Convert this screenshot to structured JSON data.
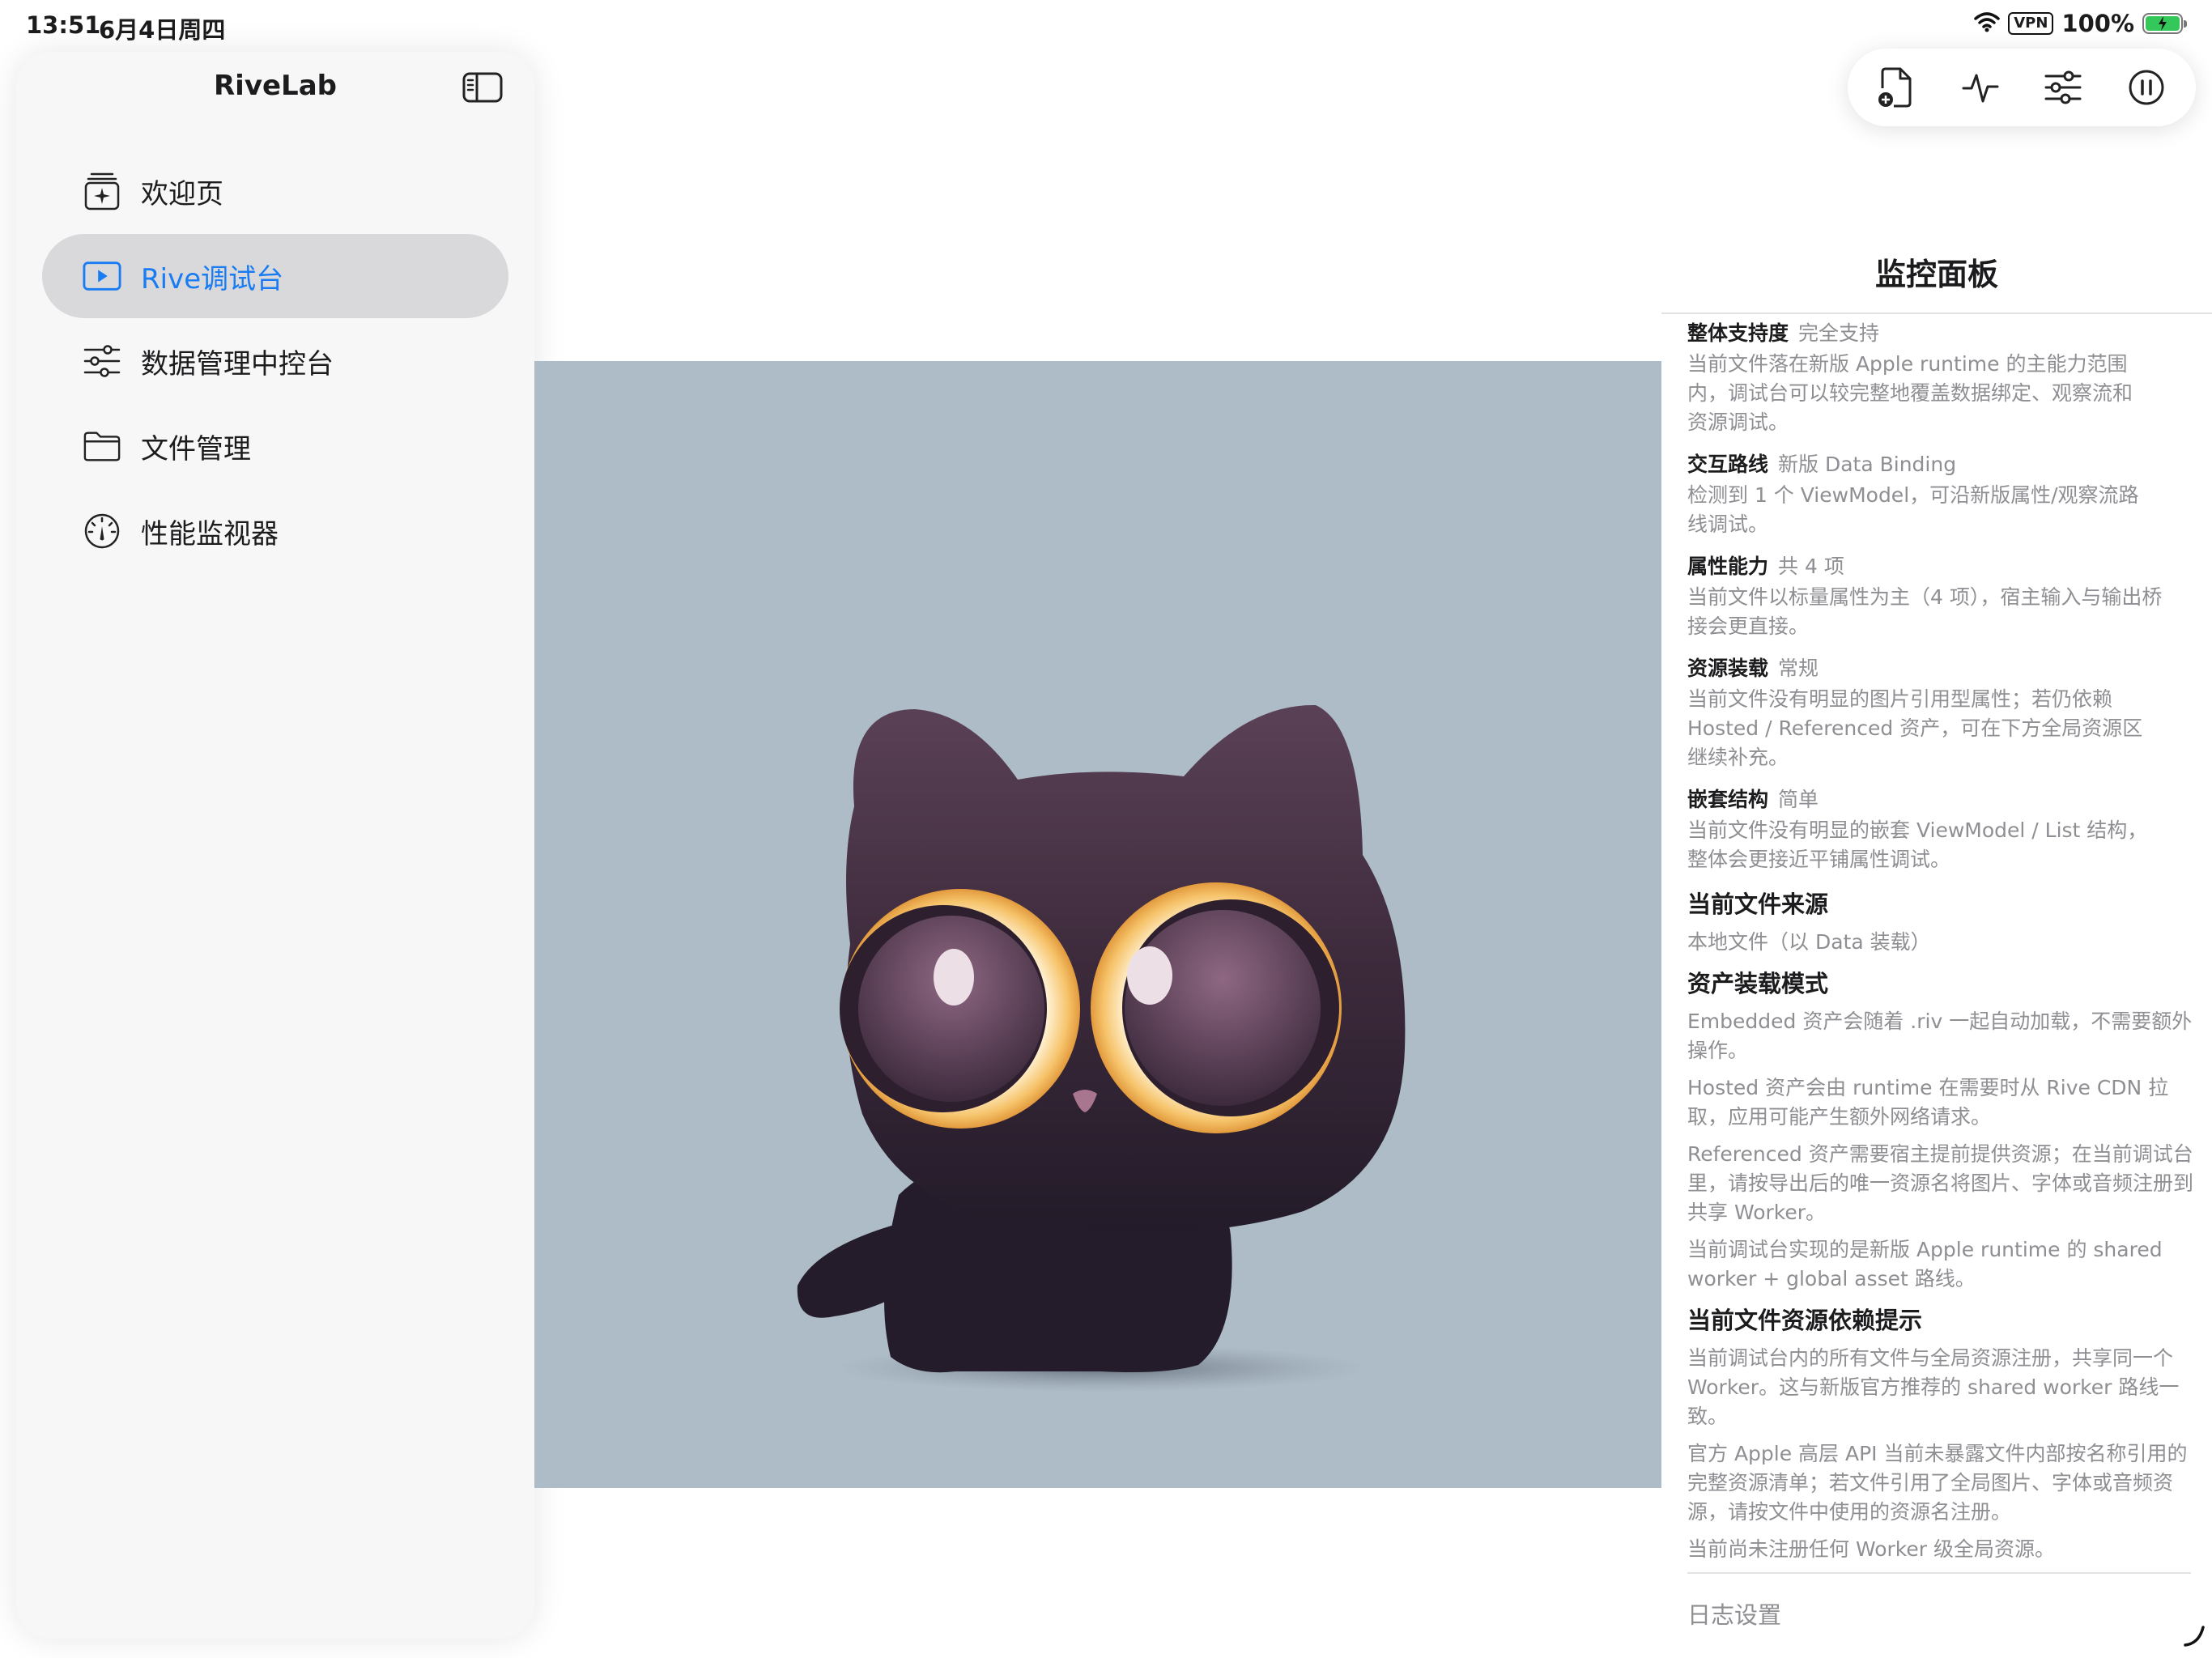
{
  "status_bar": {
    "time": "13:51",
    "date": "6月4日周四",
    "vpn": "VPN",
    "battery": "100%",
    "battery_level": 1.0
  },
  "sidebar": {
    "title": "RiveLab",
    "items": [
      {
        "label": "欢迎页",
        "icon": "welcome-icon",
        "selected": false
      },
      {
        "label": "Rive调试台",
        "icon": "play-icon",
        "selected": true
      },
      {
        "label": "数据管理中控台",
        "icon": "sliders-icon",
        "selected": false
      },
      {
        "label": "文件管理",
        "icon": "folder-icon",
        "selected": false
      },
      {
        "label": "性能监视器",
        "icon": "gauge-icon",
        "selected": false
      }
    ]
  },
  "toolbar": {
    "buttons": [
      {
        "icon": "add-file-icon"
      },
      {
        "icon": "activity-icon"
      },
      {
        "icon": "sliders-icon"
      },
      {
        "icon": "pause-icon"
      }
    ]
  },
  "panel": {
    "title": "监控面板",
    "rows": [
      {
        "key": "整体支持度",
        "value": "完全支持",
        "desc": "当前文件落在新版 Apple runtime 的主能力范围内，调试台可以较完整地覆盖数据绑定、观察流和资源调试。"
      },
      {
        "key": "交互路线",
        "value": "新版 Data Binding",
        "desc": "检测到 1 个 ViewModel，可沿新版属性/观察流路线调试。"
      },
      {
        "key": "属性能力",
        "value": "共 4 项",
        "desc": "当前文件以标量属性为主（4 项），宿主输入与输出桥接会更直接。"
      },
      {
        "key": "资源装载",
        "value": "常规",
        "desc": "当前文件没有明显的图片引用型属性；若仍依赖 Hosted / Referenced 资产，可在下方全局资源区继续补充。"
      },
      {
        "key": "嵌套结构",
        "value": "简单",
        "desc": "当前文件没有明显的嵌套 ViewModel / List 结构，整体会更接近平铺属性调试。"
      }
    ],
    "source": {
      "title": "当前文件来源",
      "text": "本地文件（以 Data 装载）"
    },
    "asset_mode": {
      "title": "资产装载模式",
      "paragraphs": [
        "Embedded 资产会随着 .riv 一起自动加载，不需要额外操作。",
        "Hosted 资产会由 runtime 在需要时从 Rive CDN 拉取，应用可能产生额外网络请求。",
        "Referenced 资产需要宿主提前提供资源；在当前调试台里，请按导出后的唯一资源名将图片、字体或音频注册到共享 Worker。",
        "当前调试台实现的是新版 Apple runtime 的 shared worker + global asset 路线。"
      ]
    },
    "dependency": {
      "title": "当前文件资源依赖提示",
      "paragraphs": [
        "当前调试台内的所有文件与全局资源注册，共享同一个 Worker。这与新版官方推荐的 shared worker 路线一致。",
        "官方 Apple 高层 API 当前未暴露文件内部按名称引用的完整资源清单；若文件引用了全局图片、字体或音频资源，请按文件中使用的资源名注册。",
        "当前尚未注册任何 Worker 级全局资源。"
      ]
    },
    "footer": "日志设置"
  },
  "colors": {
    "accent": "#1a7cf3",
    "selected_bg": "#d9d9db",
    "canvas_bg": "#aebcc7",
    "secondary_text": "#8e8e93"
  }
}
